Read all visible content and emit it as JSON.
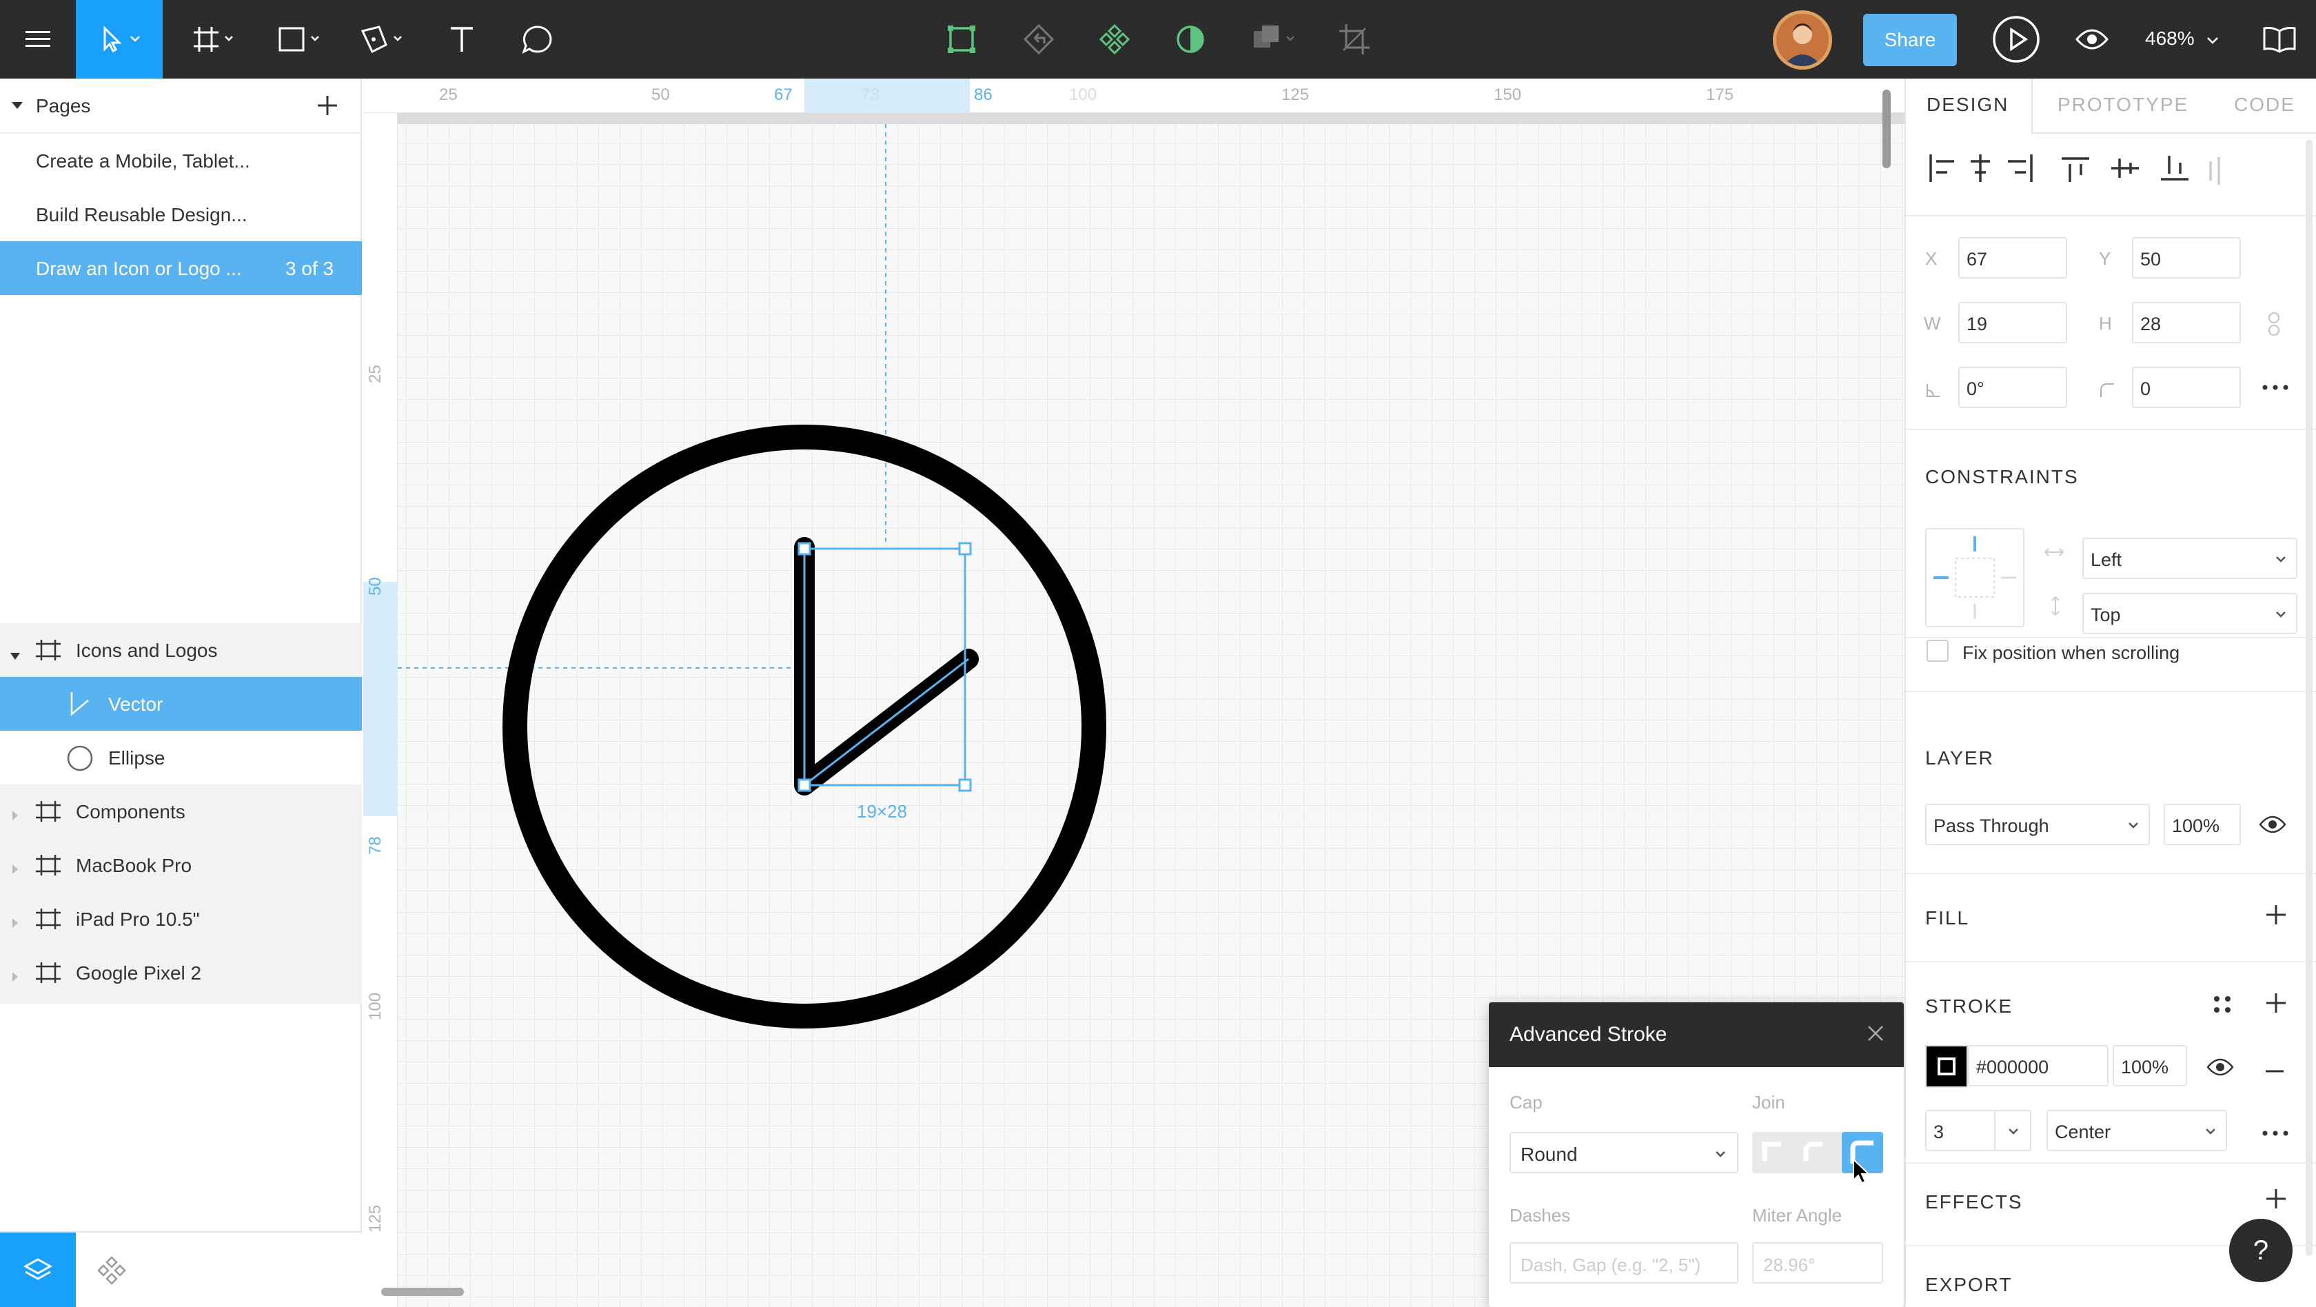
{
  "toolbar": {
    "share_label": "Share",
    "zoom": "468%"
  },
  "left": {
    "pages_title": "Pages",
    "pages": [
      {
        "label": "Create a Mobile, Tablet..."
      },
      {
        "label": "Build Reusable Design..."
      },
      {
        "label": "Draw an Icon or Logo ...",
        "count": "3 of 3"
      }
    ],
    "layers": [
      {
        "label": "Icons and Logos"
      },
      {
        "label": "Vector"
      },
      {
        "label": "Ellipse"
      },
      {
        "label": "Components"
      },
      {
        "label": "MacBook Pro"
      },
      {
        "label": "iPad Pro 10.5\""
      },
      {
        "label": "Google Pixel 2"
      }
    ]
  },
  "canvas": {
    "ruler_top": [
      "25",
      "50",
      "67",
      "73",
      "86",
      "100",
      "125",
      "150",
      "175"
    ],
    "ruler_left": [
      "25",
      "50",
      "78",
      "100",
      "125"
    ],
    "dimension_label": "19×28"
  },
  "adv_stroke": {
    "title": "Advanced Stroke",
    "cap_label": "Cap",
    "cap_value": "Round",
    "join_label": "Join",
    "dashes_label": "Dashes",
    "dashes_placeholder": "Dash, Gap (e.g. \"2, 5\")",
    "miter_label": "Miter Angle",
    "miter_placeholder": "28.96°"
  },
  "right": {
    "tabs": [
      "DESIGN",
      "PROTOTYPE",
      "CODE"
    ],
    "x_label": "X",
    "x": "67",
    "y_label": "Y",
    "y": "50",
    "w_label": "W",
    "w": "19",
    "h_label": "H",
    "h": "28",
    "rotation": "0°",
    "radius": "0",
    "constraints_title": "CONSTRAINTS",
    "constraint_h": "Left",
    "constraint_v": "Top",
    "fix_position": "Fix position when scrolling",
    "layer_title": "LAYER",
    "blend_mode": "Pass Through",
    "layer_opacity": "100%",
    "fill_title": "FILL",
    "stroke_title": "STROKE",
    "stroke_color": "#000000",
    "stroke_opacity": "100%",
    "stroke_weight": "3",
    "stroke_align": "Center",
    "effects_title": "EFFECTS",
    "export_title": "EXPORT"
  },
  "colors": {
    "accent": "#18a0fb",
    "selection": "#58b3f0",
    "toolbar_bg": "#2c2c2c",
    "stroke": "#000000"
  }
}
